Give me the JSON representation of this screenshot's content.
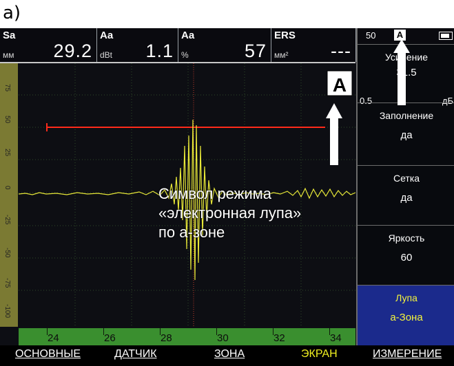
{
  "figure_label": "а)",
  "measurements": [
    {
      "name": "Sa",
      "unit": "мм",
      "value": "29.2"
    },
    {
      "name": "Aa",
      "unit": "dBt",
      "value": "1.1"
    },
    {
      "name": "Aa",
      "unit": "%",
      "value": "57"
    },
    {
      "name": "ERS",
      "unit": "мм²",
      "value": "---"
    }
  ],
  "plot": {
    "mode_symbol": "A",
    "y_ticks": [
      "75",
      "50",
      "25",
      "0",
      "-25",
      "-50",
      "-75",
      "-100"
    ],
    "x_ticks": [
      "24",
      "26",
      "28",
      "30",
      "32",
      "34"
    ]
  },
  "callout": {
    "lines": [
      "Символ режима",
      "«электронная лупа»",
      "по а-зоне"
    ]
  },
  "status": {
    "gain_step": "50",
    "mode": "A"
  },
  "side_panel": {
    "gain": {
      "label": "Усиление",
      "value": "31.5",
      "step": "0.5",
      "unit": "дБ"
    },
    "fill": {
      "label": "Заполнение",
      "value": "да"
    },
    "grid": {
      "label": "Сетка",
      "value": "да"
    },
    "brightness": {
      "label": "Яркость",
      "value": "60"
    },
    "zoom": {
      "label": "Лупа",
      "value": "а-Зона"
    }
  },
  "menu": [
    "ОСНОВНЫЕ",
    "ДАТЧИК",
    "ЗОНА",
    "ЭКРАН",
    "ИЗМЕРЕНИЕ"
  ],
  "menu_active": "ЭКРАН",
  "colors": {
    "trace": "#e8e838",
    "gate": "#ff2a1a",
    "active_tab": "#f0f020",
    "panel_active_bg": "#1b2a8c"
  }
}
